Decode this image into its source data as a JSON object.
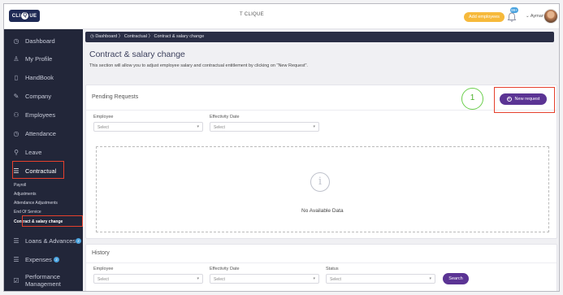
{
  "header": {
    "logo": "CLIQUE",
    "app_title": "T CLIQUE",
    "add_employees": "Add employees",
    "notif_count": "99+",
    "user_name": "Ayman"
  },
  "sidebar": {
    "items": [
      {
        "label": "Dashboard",
        "icon": "clock-icon"
      },
      {
        "label": "My Profile",
        "icon": "user-icon"
      },
      {
        "label": "HandBook",
        "icon": "book-icon"
      },
      {
        "label": "Company",
        "icon": "building-icon"
      },
      {
        "label": "Employees",
        "icon": "people-icon"
      },
      {
        "label": "Attendance",
        "icon": "clock-icon"
      },
      {
        "label": "Leave",
        "icon": "leave-icon"
      },
      {
        "label": "Contractual",
        "icon": "document-icon"
      },
      {
        "label": "Loans & Advances",
        "icon": "document-icon",
        "badge": "2"
      },
      {
        "label": "Expenses",
        "icon": "document-icon",
        "badge": "2"
      },
      {
        "label": "Performance Management",
        "icon": "check-icon"
      }
    ],
    "sub_items": [
      "Payroll",
      "Adjustments",
      "Attendance Adjustments",
      "End Of Service",
      "Contract & salary change"
    ]
  },
  "breadcrumb": [
    "Dashboard",
    "Contractual",
    "Contract & salary change"
  ],
  "page": {
    "title": "Contract & salary change",
    "description": "This section will allow you to adjust employee salary and contractual entitlement by clicking on \"New Request\"."
  },
  "pending": {
    "title": "Pending Requests",
    "new_request": "New request",
    "step_number": "1",
    "employee_label": "Employee",
    "employee_value": "Select",
    "date_label": "Effectivity Date",
    "date_value": "Select",
    "empty_text": "No Available Data"
  },
  "history": {
    "title": "History",
    "employee_label": "Employee",
    "employee_value": "Select",
    "date_label": "Effectivity Date",
    "date_value": "Select",
    "status_label": "Status",
    "status_value": "Select",
    "search": "Search"
  },
  "colors": {
    "sidebar_bg": "#222639",
    "accent_purple": "#5b3494",
    "highlight_red": "#e6402c",
    "step_green": "#6ccf4e",
    "add_button": "#f6b93b"
  }
}
